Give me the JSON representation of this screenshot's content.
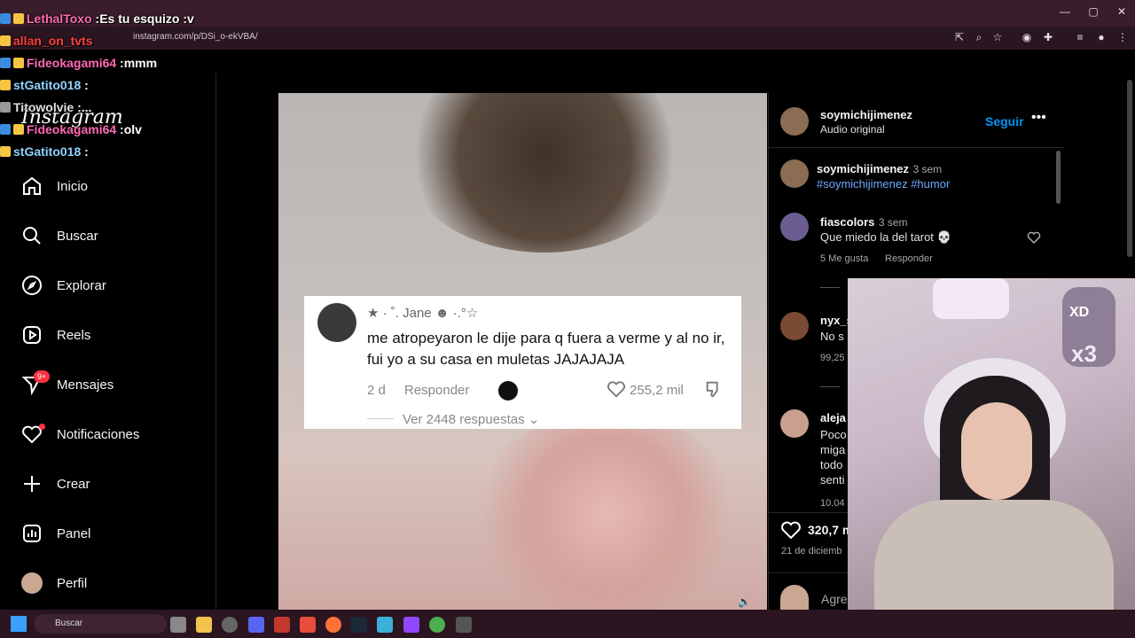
{
  "browser": {
    "url": "instagram.com/p/DSi_o-ekVBA/"
  },
  "sidebar": {
    "logo": "Instagram",
    "items": [
      {
        "label": "Inicio"
      },
      {
        "label": "Buscar"
      },
      {
        "label": "Explorar"
      },
      {
        "label": "Reels"
      },
      {
        "label": "Mensajes"
      },
      {
        "label": "Notificaciones"
      },
      {
        "label": "Crear"
      },
      {
        "label": "Panel"
      },
      {
        "label": "Perfil"
      }
    ],
    "messages_badge": "9+"
  },
  "video": {
    "card": {
      "user": "★ · ˚. Jane ☻ ·.°☆",
      "text": "me atropeyaron le dije para q fuera a verme y al no ir, fui yo a su casa en muletas JAJAJAJA",
      "time": "2 d",
      "reply": "Responder",
      "likes": "255,2 mil",
      "more": "Ver 2448 respuestas"
    }
  },
  "post": {
    "author": "soymichijimenez",
    "audio": "Audio original",
    "follow": "Seguir",
    "caption_user": "soymichijimenez",
    "caption_time": "3 sem",
    "caption_tags": "#soymichijimenez #humor",
    "comments": [
      {
        "user": "fiascolors",
        "time": "3 sem",
        "text": "Que miedo la del tarot 💀",
        "likes": "5 Me gusta",
        "reply": "Responder"
      },
      {
        "user": "nyx_s",
        "text": "No s",
        "likes": "99,25"
      },
      {
        "user": "aleja",
        "text": "Poco miga todo senti",
        "likes": "10.04"
      }
    ],
    "like_count": "320,7 m",
    "date": "21 de diciemb",
    "add_comment": "Agre"
  },
  "chat": [
    {
      "user": "LethalToxo",
      "msg": "Es tu esquizo :v",
      "color": "#ff69b4"
    },
    {
      "user": "allan_on_tvts",
      "msg": "",
      "color": "#ff4040"
    },
    {
      "user": "Fideokagami64",
      "msg": "mmm",
      "color": "#ff69b4"
    },
    {
      "user": "stGatito018",
      "msg": "",
      "color": "#8fd3ff"
    },
    {
      "user": "Titowolvie",
      "msg": "...",
      "color": "#e0e0e0"
    },
    {
      "user": "Fideokagami64",
      "msg": "olv",
      "color": "#ff69b4"
    },
    {
      "user": "stGatito018",
      "msg": "",
      "color": "#8fd3ff"
    }
  ],
  "taskbar": {
    "search": "Buscar"
  },
  "stream": {
    "sticker": "XD",
    "multiplier": "x3"
  },
  "colors": {
    "accent": "#0095f6",
    "link": "#6ea8ff",
    "badge": "#ff3040"
  }
}
